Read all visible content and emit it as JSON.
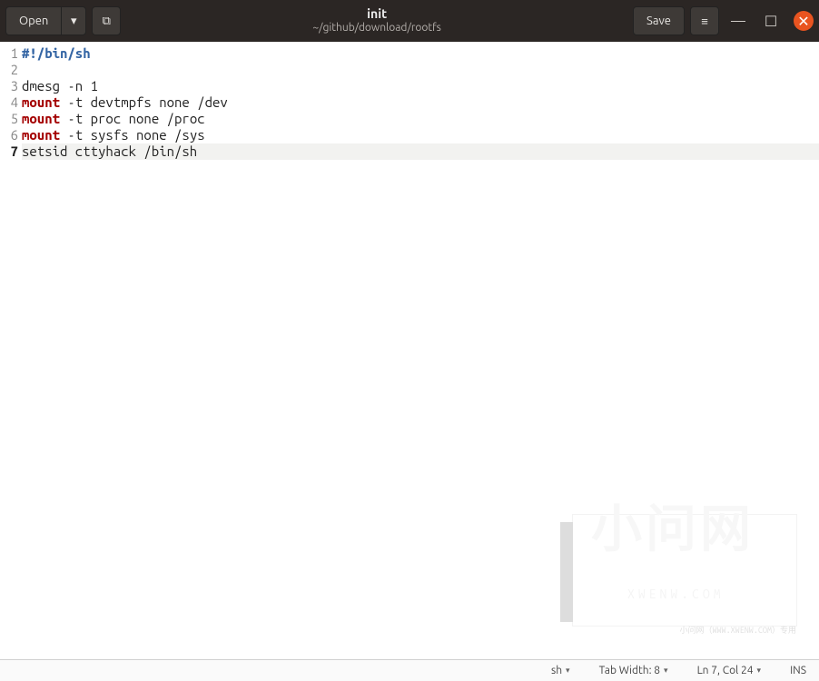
{
  "titlebar": {
    "open_label": "Open",
    "save_label": "Save",
    "file_title": "init",
    "file_path": "~/github/download/rootfs",
    "caret_glyph": "▾",
    "newtab_glyph": "⧉",
    "menu_glyph": "≡",
    "min_glyph": "—",
    "max_glyph": "☐",
    "close_glyph": "✕"
  },
  "editor": {
    "current_line": 7,
    "lines": [
      {
        "n": 1,
        "tokens": [
          [
            "shebang",
            "#!/bin/sh"
          ]
        ]
      },
      {
        "n": 2,
        "tokens": []
      },
      {
        "n": 3,
        "tokens": [
          [
            "plain",
            "dmesg -n 1"
          ]
        ]
      },
      {
        "n": 4,
        "tokens": [
          [
            "cmd",
            "mount"
          ],
          [
            "plain",
            " -t devtmpfs none /dev"
          ]
        ]
      },
      {
        "n": 5,
        "tokens": [
          [
            "cmd",
            "mount"
          ],
          [
            "plain",
            " -t proc none /proc"
          ]
        ]
      },
      {
        "n": 6,
        "tokens": [
          [
            "cmd",
            "mount"
          ],
          [
            "plain",
            " -t sysfs none /sys"
          ]
        ]
      },
      {
        "n": 7,
        "tokens": [
          [
            "plain",
            "setsid cttyhack /bin/sh"
          ]
        ]
      }
    ]
  },
  "statusbar": {
    "language": "sh",
    "tab_width_label": "Tab Width: 8",
    "cursor_label": "Ln 7, Col 24",
    "insert_mode": "INS",
    "caret_glyph": "▾"
  },
  "watermark": {
    "big": "小问网",
    "small": "XWENW.COM",
    "foot": "小问网（WWW.XWENW.COM）专用"
  }
}
